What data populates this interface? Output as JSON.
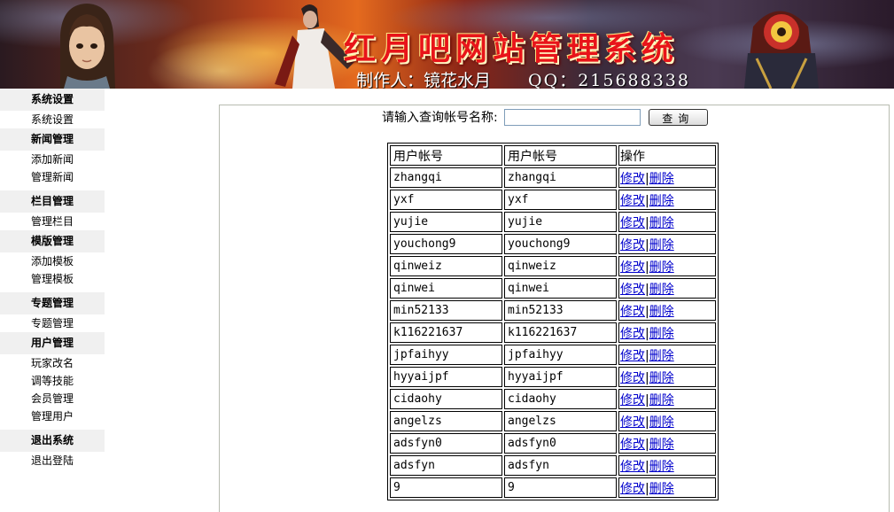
{
  "banner": {
    "title": "红月吧网站管理系统",
    "maker_label": "制作人：",
    "maker_name": "镜花水月",
    "qq_label": "QQ：",
    "qq_number": "215688338"
  },
  "sidebar": {
    "groups": [
      {
        "header": "系统设置",
        "items": [
          "系统设置"
        ]
      },
      {
        "header": "新闻管理",
        "items": [
          "添加新闻",
          "管理新闻"
        ]
      },
      {
        "header": "栏目管理",
        "items": [
          "管理栏目"
        ]
      },
      {
        "header": "模版管理",
        "items": [
          "添加模板",
          "管理模板"
        ]
      },
      {
        "header": "专题管理",
        "items": [
          "专题管理"
        ]
      },
      {
        "header": "用户管理",
        "items": [
          "玩家改名",
          "调等技能",
          "会员管理",
          "管理用户"
        ]
      },
      {
        "header": "退出系统",
        "items": [
          "退出登陆"
        ]
      }
    ]
  },
  "search": {
    "label": "请输入查询帐号名称:",
    "value": "",
    "button": "查询"
  },
  "table": {
    "headers": [
      "用户帐号",
      "用户帐号",
      "操作"
    ],
    "edit_label": "修改",
    "separator": "|",
    "delete_label": "删除",
    "rows": [
      [
        "zhangqi",
        "zhangqi"
      ],
      [
        "yxf",
        "yxf"
      ],
      [
        "yujie",
        "yujie"
      ],
      [
        "youchong9",
        "youchong9"
      ],
      [
        "qinweiz",
        "qinweiz"
      ],
      [
        "qinwei",
        "qinwei"
      ],
      [
        "min52133",
        "min52133"
      ],
      [
        "k116221637",
        "k116221637"
      ],
      [
        "jpfaihyy",
        "jpfaihyy"
      ],
      [
        "hyyaijpf",
        "hyyaijpf"
      ],
      [
        "cidaohy",
        "cidaohy"
      ],
      [
        "angelzs",
        "angelzs"
      ],
      [
        "adsfyn0",
        "adsfyn0"
      ],
      [
        "adsfyn",
        "adsfyn"
      ],
      [
        "9",
        "9"
      ]
    ]
  }
}
